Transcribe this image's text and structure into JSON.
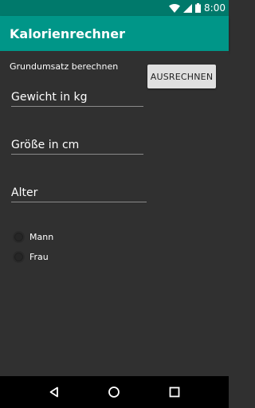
{
  "status_bar": {
    "time": "8:00"
  },
  "app_bar": {
    "title": "Kalorienrechner"
  },
  "form": {
    "section_label": "Grundumsatz berechnen",
    "calculate_button": "AUSRECHNEN",
    "weight_placeholder": "Gewicht in kg",
    "height_placeholder": "Größe in cm",
    "age_placeholder": "Alter",
    "gender_options": [
      "Mann",
      "Frau"
    ]
  },
  "nav_bar": {
    "icons": [
      "back-icon",
      "home-icon",
      "recents-icon"
    ]
  },
  "colors": {
    "primary": "#009688",
    "primary_dark": "#00796b",
    "background": "#303030"
  }
}
